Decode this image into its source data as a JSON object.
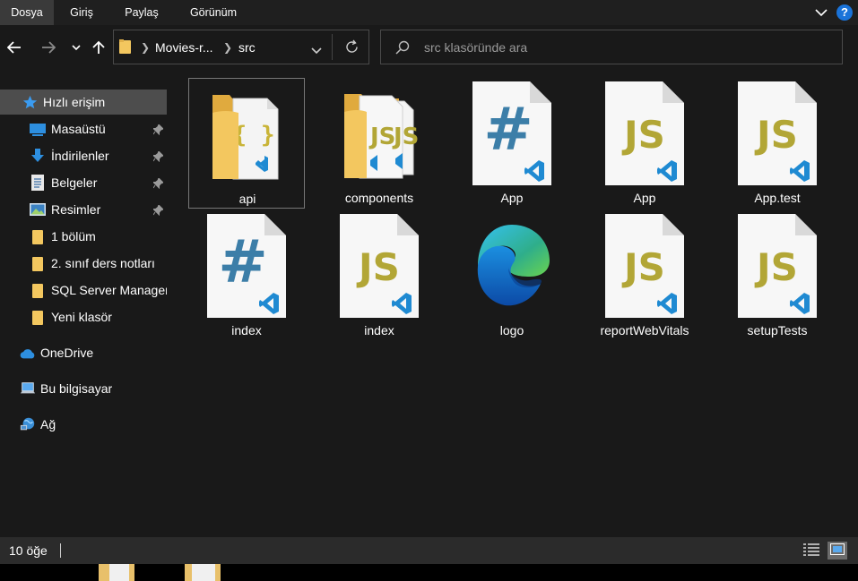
{
  "ribbon": {
    "tabs": [
      {
        "label": "Dosya",
        "active": true
      },
      {
        "label": "Giriş",
        "active": false
      },
      {
        "label": "Paylaş",
        "active": false
      },
      {
        "label": "Görünüm",
        "active": false
      }
    ],
    "help_label": "?"
  },
  "address": {
    "crumbs": [
      "Movies-r...",
      "src"
    ],
    "search_placeholder": "src klasöründe ara"
  },
  "sidebar": {
    "quick_access": "Hızlı erişim",
    "items": [
      {
        "label": "Masaüstü",
        "icon": "desktop-icon",
        "pinned": true
      },
      {
        "label": "İndirilenler",
        "icon": "download-icon",
        "pinned": true
      },
      {
        "label": "Belgeler",
        "icon": "documents-icon",
        "pinned": true
      },
      {
        "label": "Resimler",
        "icon": "pictures-icon",
        "pinned": true
      },
      {
        "label": "1 bölüm",
        "icon": "folder-icon",
        "pinned": false
      },
      {
        "label": "2. sınıf ders notları",
        "icon": "folder-icon",
        "pinned": false
      },
      {
        "label": "SQL Server Management",
        "icon": "folder-icon",
        "pinned": false
      },
      {
        "label": "Yeni klasör",
        "icon": "folder-icon",
        "pinned": false
      }
    ],
    "onedrive": "OneDrive",
    "this_pc": "Bu bilgisayar",
    "network": "Ağ"
  },
  "files": [
    {
      "name": "api",
      "kind": "folder-json",
      "selected": true
    },
    {
      "name": "components",
      "kind": "folder-js",
      "selected": false
    },
    {
      "name": "App",
      "kind": "css",
      "selected": false
    },
    {
      "name": "App",
      "kind": "js",
      "selected": false
    },
    {
      "name": "App.test",
      "kind": "js",
      "selected": false
    },
    {
      "name": "index",
      "kind": "css",
      "selected": false
    },
    {
      "name": "index",
      "kind": "js",
      "selected": false
    },
    {
      "name": "logo",
      "kind": "edge",
      "selected": false
    },
    {
      "name": "reportWebVitals",
      "kind": "js",
      "selected": false
    },
    {
      "name": "setupTests",
      "kind": "js",
      "selected": false
    }
  ],
  "status": {
    "count_text": "10 öğe"
  },
  "colors": {
    "folder": "#f3c75f",
    "js_text": "#b2a636",
    "css_hash": "#3c7ea8",
    "vscode_blue": "#1f8ad2",
    "accent": "#1a73d9"
  }
}
